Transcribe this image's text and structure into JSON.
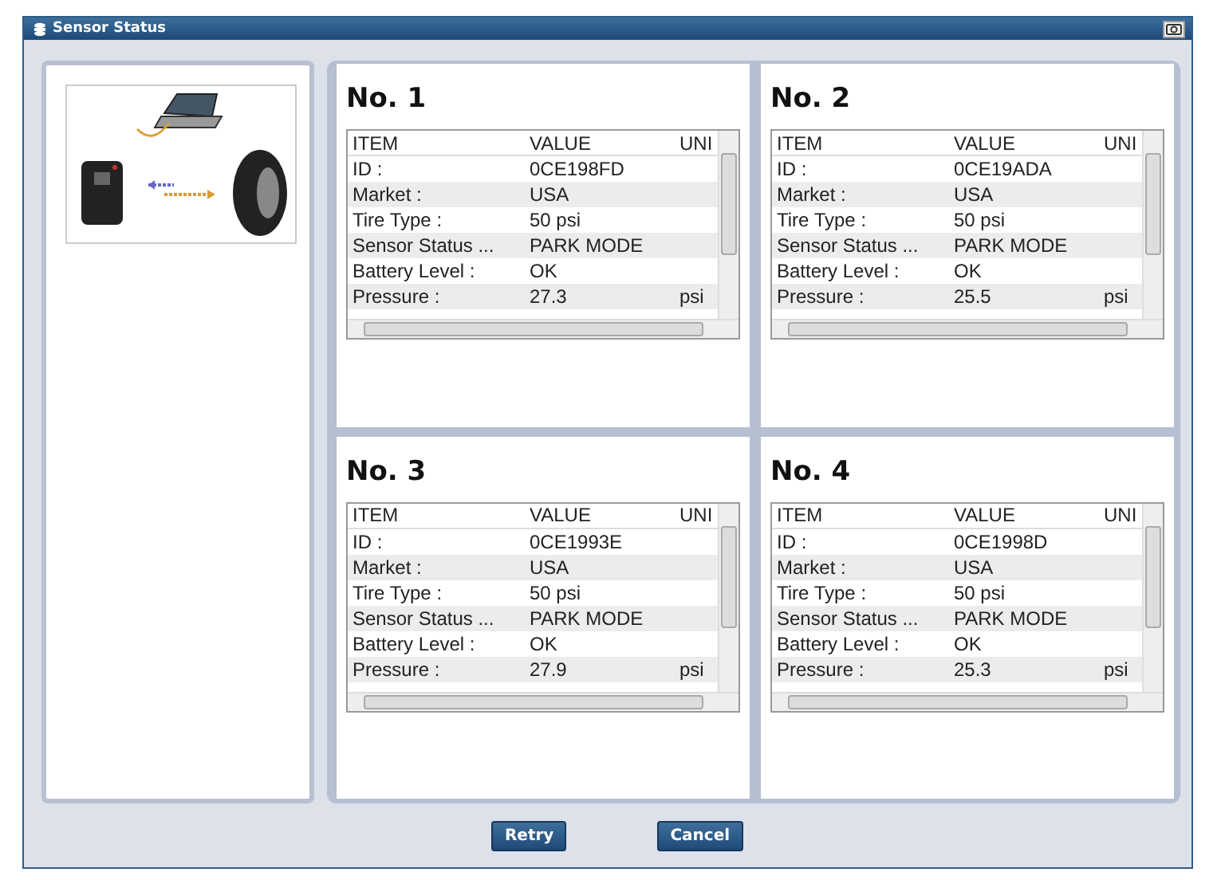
{
  "window": {
    "title": "Sensor Status"
  },
  "sensors": [
    {
      "title": "No. 1",
      "columns": [
        "ITEM",
        "VALUE",
        "UNI"
      ],
      "rows": [
        {
          "item": "ID :",
          "value": "0CE198FD",
          "unit": ""
        },
        {
          "item": "Market :",
          "value": "USA",
          "unit": ""
        },
        {
          "item": "Tire Type :",
          "value": "50 psi",
          "unit": ""
        },
        {
          "item": "Sensor Status ...",
          "value": "PARK MODE",
          "unit": ""
        },
        {
          "item": "Battery Level :",
          "value": "OK",
          "unit": ""
        },
        {
          "item": "Pressure :",
          "value": "27.3",
          "unit": "psi"
        }
      ]
    },
    {
      "title": "No. 2",
      "columns": [
        "ITEM",
        "VALUE",
        "UNI"
      ],
      "rows": [
        {
          "item": "ID :",
          "value": "0CE19ADA",
          "unit": ""
        },
        {
          "item": "Market :",
          "value": "USA",
          "unit": ""
        },
        {
          "item": "Tire Type :",
          "value": "50 psi",
          "unit": ""
        },
        {
          "item": "Sensor Status ...",
          "value": "PARK MODE",
          "unit": ""
        },
        {
          "item": "Battery Level :",
          "value": "OK",
          "unit": ""
        },
        {
          "item": "Pressure :",
          "value": "25.5",
          "unit": "psi"
        }
      ]
    },
    {
      "title": "No. 3",
      "columns": [
        "ITEM",
        "VALUE",
        "UNI"
      ],
      "rows": [
        {
          "item": "ID :",
          "value": "0CE1993E",
          "unit": ""
        },
        {
          "item": "Market :",
          "value": "USA",
          "unit": ""
        },
        {
          "item": "Tire Type :",
          "value": "50 psi",
          "unit": ""
        },
        {
          "item": "Sensor Status ...",
          "value": "PARK MODE",
          "unit": ""
        },
        {
          "item": "Battery Level :",
          "value": "OK",
          "unit": ""
        },
        {
          "item": "Pressure :",
          "value": "27.9",
          "unit": "psi"
        }
      ]
    },
    {
      "title": "No. 4",
      "columns": [
        "ITEM",
        "VALUE",
        "UNI"
      ],
      "rows": [
        {
          "item": "ID :",
          "value": "0CE1998D",
          "unit": ""
        },
        {
          "item": "Market :",
          "value": "USA",
          "unit": ""
        },
        {
          "item": "Tire Type :",
          "value": "50 psi",
          "unit": ""
        },
        {
          "item": "Sensor Status ...",
          "value": "PARK MODE",
          "unit": ""
        },
        {
          "item": "Battery Level :",
          "value": "OK",
          "unit": ""
        },
        {
          "item": "Pressure :",
          "value": "25.3",
          "unit": "psi"
        }
      ]
    }
  ],
  "buttons": [
    "Retry",
    "Cancel"
  ]
}
